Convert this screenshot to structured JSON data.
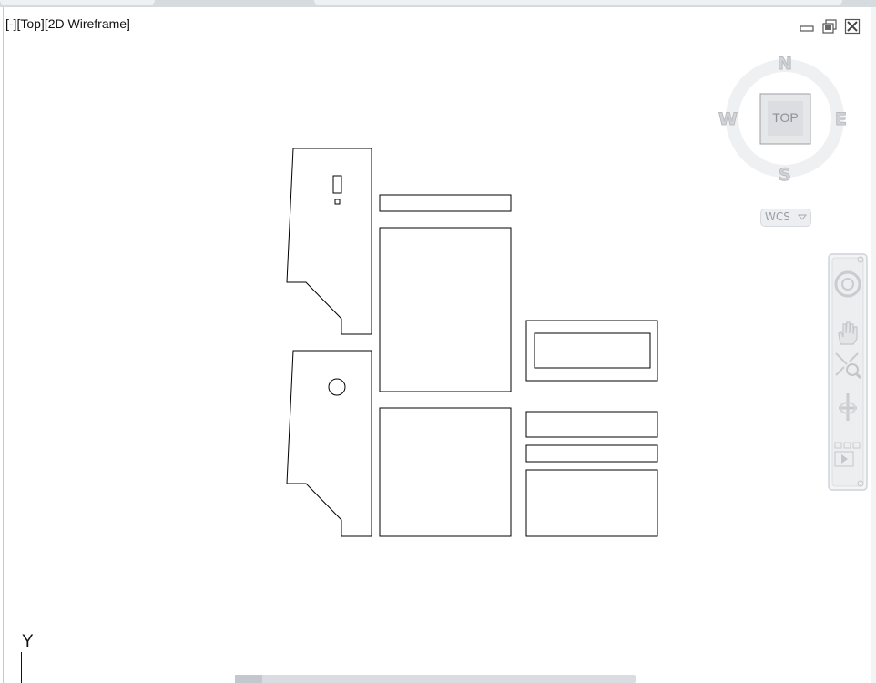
{
  "viewport": {
    "controls": [
      "[-]",
      "[Top]",
      "[2D Wireframe]"
    ]
  },
  "viewcube": {
    "face": "TOP",
    "north": "N",
    "south": "S",
    "east": "E",
    "west": "W",
    "ucs_menu": "WCS"
  },
  "navbar": {
    "tools": [
      "steering-wheel-icon",
      "pan-hand-icon",
      "zoom-extents-icon",
      "orbit-icon",
      "showmotion-icon"
    ]
  },
  "ucs_icon": {
    "y_label": "Y"
  },
  "colors": {
    "background": "#ffffff",
    "geometry": "#000000",
    "viewcube_gray": "#d0d3d7",
    "chrome": "#d6dbe0"
  }
}
